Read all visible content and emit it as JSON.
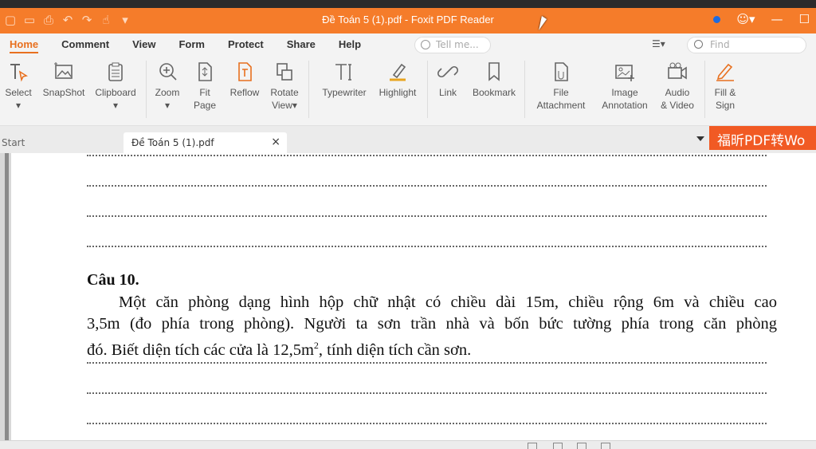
{
  "window": {
    "title": "Đề Toán 5 (1).pdf - Foxit PDF Reader"
  },
  "menus": [
    "Home",
    "Comment",
    "View",
    "Form",
    "Protect",
    "Share",
    "Help"
  ],
  "active_menu": "Home",
  "tellme": {
    "placeholder": "Tell me..."
  },
  "find": {
    "placeholder": "Find"
  },
  "ribbon": {
    "select": "Select",
    "snapshot": "SnapShot",
    "clipboard": "Clipboard",
    "zoom": "Zoom",
    "fit": "Fit",
    "fit2": "Page",
    "reflow": "Reflow",
    "rotate": "Rotate",
    "rotate2": "View",
    "typewriter": "Typewriter",
    "highlight": "Highlight",
    "link": "Link",
    "bookmark": "Bookmark",
    "file": "File",
    "file2": "Attachment",
    "image": "Image",
    "image2": "Annotation",
    "audio": "Audio",
    "audio2": "& Video",
    "fill": "Fill &",
    "fill2": "Sign"
  },
  "tabs": {
    "start": "Start",
    "doc": "Đề Toán 5 (1).pdf",
    "close": "×",
    "promo": "福昕PDF转Wo"
  },
  "doc": {
    "heading": "Câu 10.",
    "line1": "Một căn phòng dạng hình hộp chữ nhật có chiều dài 15m, chiều rộng 6m và chiều cao",
    "line2": "3,5m (đo phía trong phòng). Người ta sơn trần nhà và bốn bức tường phía trong căn phòng",
    "line3a": "đó. Biết diện tích các cửa là 12,5m",
    "line3sup": "2",
    "line3b": ", tính diện tích cần sơn."
  },
  "colors": {
    "accent": "#f57c2a",
    "promo": "#f15a24"
  }
}
